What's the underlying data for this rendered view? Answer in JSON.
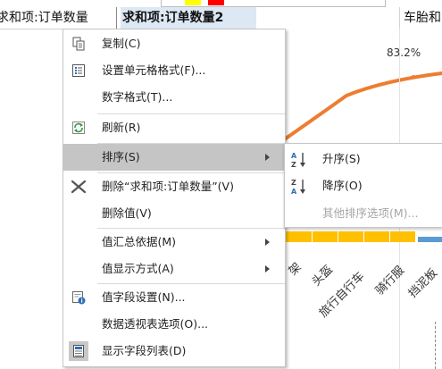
{
  "sheet": {
    "header_cells": [
      "求和项:订单数量",
      "求和项:订单数量2",
      "车胎和"
    ],
    "chart": {
      "percent_label": "83.2%",
      "x_labels": [
        "架",
        "头盔",
        "旅行自行车",
        "骑行服",
        "挡泥板"
      ],
      "colors": {
        "line": "#ed7d31",
        "bars": "#ffc000",
        "bars2": "#5b9bd5"
      }
    }
  },
  "context_menu": {
    "items": [
      {
        "label": "复制(C)",
        "icon": "copy-icon"
      },
      {
        "label": "设置单元格格式(F)...",
        "icon": "format-cells-icon"
      },
      {
        "label": "数字格式(T)...",
        "icon": ""
      },
      {
        "label": "刷新(R)",
        "icon": "refresh-icon"
      },
      {
        "label": "排序(S)",
        "icon": "",
        "submenu": true,
        "highlighted": true
      },
      {
        "label": "删除“求和项:订单数量”(V)",
        "icon": "delete-x-icon"
      },
      {
        "label": "删除值(V)",
        "icon": ""
      },
      {
        "label": "值汇总依据(M)",
        "icon": "",
        "submenu": true
      },
      {
        "label": "值显示方式(A)",
        "icon": "",
        "submenu": true
      },
      {
        "label": "值字段设置(N)...",
        "icon": "field-settings-icon"
      },
      {
        "label": "数据透视表选项(O)...",
        "icon": ""
      },
      {
        "label": "显示字段列表(D)",
        "icon": "field-list-icon"
      }
    ]
  },
  "sort_submenu": {
    "items": [
      {
        "label": "升序(S)",
        "icon": "sort-ascending-icon",
        "enabled": true
      },
      {
        "label": "降序(O)",
        "icon": "sort-descending-icon",
        "enabled": true
      },
      {
        "label": "其他排序选项(M)...",
        "icon": "",
        "enabled": false
      }
    ]
  }
}
